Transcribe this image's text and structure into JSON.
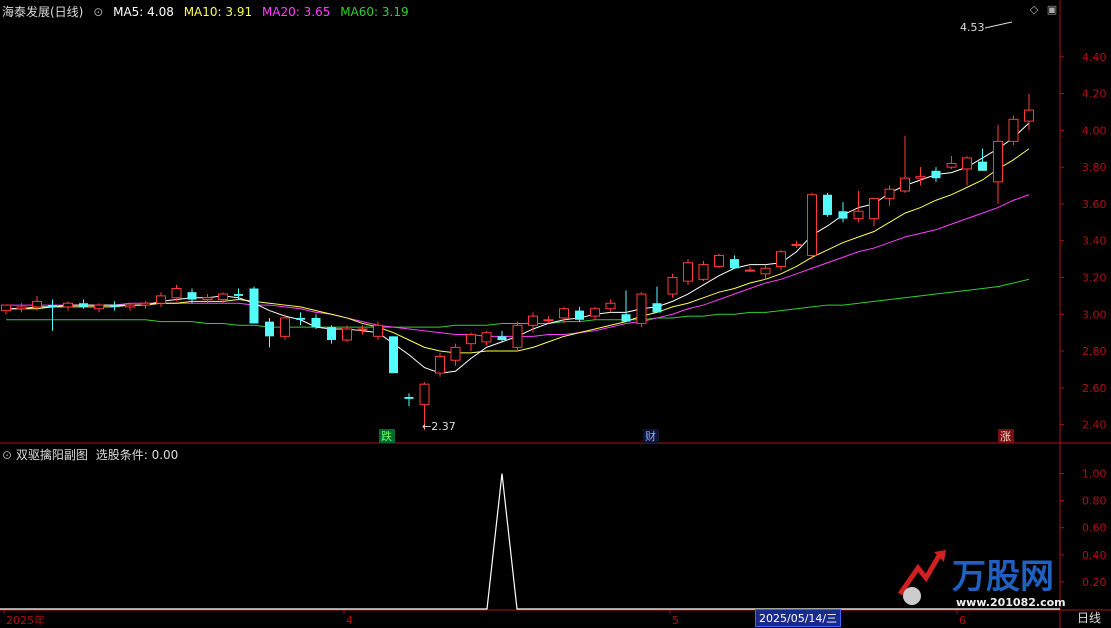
{
  "header": {
    "stock": "海泰发展(日线)",
    "ma5": "MA5: 4.08",
    "ma10": "MA10: 3.91",
    "ma20": "MA20: 3.65",
    "ma60": "MA60: 3.19"
  },
  "sub_header": {
    "title": "双驱擒阳副图",
    "condition": "选股条件: 0.00"
  },
  "price_axis": [
    "4.40",
    "4.20",
    "4.00",
    "3.80",
    "3.60",
    "3.40",
    "3.20",
    "3.00",
    "2.80",
    "2.60",
    "2.40"
  ],
  "sub_axis": [
    "1.00",
    "0.80",
    "0.60",
    "0.40",
    "0.20"
  ],
  "x_labels": [
    {
      "text": "2025年"
    },
    {
      "text": "4"
    },
    {
      "text": "5"
    },
    {
      "text": "6"
    }
  ],
  "cursor_date": "2025/05/14/三",
  "period_label": "日线",
  "annotations": {
    "high": "4.53",
    "low": "2.37",
    "marker_fall": "跌",
    "marker_fin": "财",
    "marker_rise": "涨"
  },
  "watermark": {
    "brand": "万股网",
    "url": "www.201082.com"
  },
  "colors": {
    "up": "#ff3b3b",
    "down": "#54fcfc",
    "ma5": "#ffffff",
    "ma10": "#ffff50",
    "ma20": "#ff40ff",
    "ma60": "#30d030",
    "axis": "#b01010",
    "sub_line": "#ffffff"
  },
  "chart_data": {
    "type": "candlestick",
    "y_range": [
      2.3,
      4.6
    ],
    "candles": [
      [
        3.02,
        3.05,
        3.0,
        3.05
      ],
      [
        3.03,
        3.06,
        3.01,
        3.04
      ],
      [
        3.04,
        3.1,
        3.02,
        3.07
      ],
      [
        3.05,
        3.08,
        2.91,
        3.04
      ],
      [
        3.04,
        3.07,
        3.02,
        3.06
      ],
      [
        3.06,
        3.08,
        3.03,
        3.04
      ],
      [
        3.03,
        3.06,
        3.01,
        3.05
      ],
      [
        3.05,
        3.07,
        3.02,
        3.04
      ],
      [
        3.04,
        3.06,
        3.02,
        3.05
      ],
      [
        3.05,
        3.07,
        3.03,
        3.06
      ],
      [
        3.06,
        3.12,
        3.04,
        3.1
      ],
      [
        3.09,
        3.16,
        3.07,
        3.14
      ],
      [
        3.12,
        3.14,
        3.06,
        3.08
      ],
      [
        3.08,
        3.11,
        3.06,
        3.09
      ],
      [
        3.08,
        3.12,
        3.06,
        3.11
      ],
      [
        3.11,
        3.14,
        3.08,
        3.1
      ],
      [
        3.14,
        3.15,
        2.95,
        2.95
      ],
      [
        2.96,
        2.98,
        2.82,
        2.88
      ],
      [
        2.88,
        3.0,
        2.86,
        2.98
      ],
      [
        2.98,
        3.01,
        2.94,
        2.97
      ],
      [
        2.98,
        3.0,
        2.92,
        2.93
      ],
      [
        2.93,
        2.94,
        2.84,
        2.86
      ],
      [
        2.86,
        2.94,
        2.85,
        2.92
      ],
      [
        2.92,
        2.94,
        2.89,
        2.92
      ],
      [
        2.88,
        2.96,
        2.86,
        2.94
      ],
      [
        2.88,
        2.88,
        2.68,
        2.68
      ],
      [
        2.55,
        2.57,
        2.5,
        2.54
      ],
      [
        2.51,
        2.63,
        2.37,
        2.62
      ],
      [
        2.68,
        2.79,
        2.66,
        2.77
      ],
      [
        2.75,
        2.84,
        2.72,
        2.82
      ],
      [
        2.84,
        2.9,
        2.8,
        2.89
      ],
      [
        2.85,
        2.91,
        2.83,
        2.9
      ],
      [
        2.88,
        2.91,
        2.85,
        2.86
      ],
      [
        2.82,
        2.96,
        2.8,
        2.94
      ],
      [
        2.94,
        3.01,
        2.9,
        2.99
      ],
      [
        2.97,
        2.99,
        2.95,
        2.97
      ],
      [
        2.98,
        3.04,
        2.95,
        3.03
      ],
      [
        3.02,
        3.04,
        2.96,
        2.97
      ],
      [
        2.99,
        3.04,
        2.97,
        3.03
      ],
      [
        3.03,
        3.08,
        3.01,
        3.06
      ],
      [
        3.0,
        3.13,
        2.98,
        2.96
      ],
      [
        2.95,
        3.12,
        2.93,
        3.11
      ],
      [
        3.06,
        3.15,
        3.03,
        3.01
      ],
      [
        3.11,
        3.22,
        3.09,
        3.2
      ],
      [
        3.18,
        3.3,
        3.16,
        3.28
      ],
      [
        3.19,
        3.29,
        3.18,
        3.27
      ],
      [
        3.26,
        3.33,
        3.25,
        3.32
      ],
      [
        3.3,
        3.32,
        3.25,
        3.25
      ],
      [
        3.24,
        3.26,
        3.23,
        3.24
      ],
      [
        3.22,
        3.27,
        3.19,
        3.25
      ],
      [
        3.26,
        3.35,
        3.24,
        3.34
      ],
      [
        3.38,
        3.4,
        3.36,
        3.38
      ],
      [
        3.32,
        3.66,
        3.3,
        3.65
      ],
      [
        3.65,
        3.66,
        3.53,
        3.54
      ],
      [
        3.56,
        3.61,
        3.5,
        3.52
      ],
      [
        3.52,
        3.67,
        3.5,
        3.56
      ],
      [
        3.52,
        3.63,
        3.48,
        3.63
      ],
      [
        3.63,
        3.7,
        3.59,
        3.68
      ],
      [
        3.67,
        3.97,
        3.66,
        3.74
      ],
      [
        3.74,
        3.8,
        3.7,
        3.75
      ],
      [
        3.78,
        3.8,
        3.72,
        3.74
      ],
      [
        3.8,
        3.86,
        3.79,
        3.82
      ],
      [
        3.79,
        3.86,
        3.7,
        3.85
      ],
      [
        3.83,
        3.9,
        3.78,
        3.78
      ],
      [
        3.72,
        4.03,
        3.6,
        3.94
      ],
      [
        3.94,
        4.08,
        3.92,
        4.06
      ],
      [
        4.05,
        4.2,
        4.0,
        4.11
      ]
    ],
    "ma5": [
      3.03,
      3.03,
      3.04,
      3.04,
      3.05,
      3.05,
      3.05,
      3.05,
      3.05,
      3.05,
      3.07,
      3.08,
      3.09,
      3.09,
      3.1,
      3.09,
      3.06,
      3.02,
      2.99,
      2.97,
      2.93,
      2.92,
      2.92,
      2.91,
      2.9,
      2.84,
      2.78,
      2.71,
      2.68,
      2.69,
      2.76,
      2.82,
      2.85,
      2.88,
      2.92,
      2.95,
      2.97,
      2.98,
      3.0,
      3.01,
      3.01,
      3.03,
      3.04,
      3.07,
      3.11,
      3.16,
      3.21,
      3.25,
      3.27,
      3.27,
      3.28,
      3.34,
      3.43,
      3.48,
      3.54,
      3.58,
      3.6,
      3.66,
      3.7,
      3.73,
      3.76,
      3.77,
      3.8,
      3.85,
      3.9,
      3.96,
      4.04
    ],
    "ma10": [
      3.03,
      3.03,
      3.03,
      3.04,
      3.04,
      3.04,
      3.04,
      3.04,
      3.05,
      3.05,
      3.06,
      3.06,
      3.07,
      3.07,
      3.07,
      3.08,
      3.07,
      3.06,
      3.05,
      3.04,
      3.02,
      3.0,
      2.98,
      2.95,
      2.93,
      2.9,
      2.86,
      2.82,
      2.8,
      2.79,
      2.79,
      2.8,
      2.8,
      2.8,
      2.82,
      2.85,
      2.88,
      2.9,
      2.92,
      2.94,
      2.96,
      2.99,
      3.01,
      3.04,
      3.06,
      3.09,
      3.12,
      3.14,
      3.17,
      3.19,
      3.22,
      3.26,
      3.31,
      3.35,
      3.39,
      3.42,
      3.45,
      3.5,
      3.55,
      3.58,
      3.62,
      3.65,
      3.69,
      3.73,
      3.79,
      3.84,
      3.9
    ],
    "ma20": [
      3.05,
      3.05,
      3.05,
      3.05,
      3.05,
      3.05,
      3.05,
      3.05,
      3.06,
      3.06,
      3.06,
      3.06,
      3.06,
      3.06,
      3.06,
      3.06,
      3.05,
      3.05,
      3.04,
      3.03,
      3.01,
      3.0,
      2.98,
      2.96,
      2.94,
      2.93,
      2.92,
      2.91,
      2.9,
      2.89,
      2.89,
      2.88,
      2.88,
      2.88,
      2.88,
      2.89,
      2.89,
      2.9,
      2.91,
      2.93,
      2.95,
      2.96,
      2.98,
      3.0,
      3.03,
      3.05,
      3.08,
      3.11,
      3.14,
      3.17,
      3.19,
      3.22,
      3.25,
      3.28,
      3.31,
      3.34,
      3.36,
      3.39,
      3.42,
      3.44,
      3.46,
      3.49,
      3.52,
      3.55,
      3.58,
      3.62,
      3.65
    ],
    "ma60": [
      2.97,
      2.97,
      2.97,
      2.97,
      2.97,
      2.97,
      2.97,
      2.97,
      2.97,
      2.97,
      2.96,
      2.96,
      2.96,
      2.95,
      2.95,
      2.94,
      2.94,
      2.93,
      2.93,
      2.93,
      2.93,
      2.93,
      2.93,
      2.93,
      2.93,
      2.93,
      2.93,
      2.93,
      2.93,
      2.94,
      2.94,
      2.94,
      2.95,
      2.95,
      2.95,
      2.95,
      2.96,
      2.96,
      2.97,
      2.97,
      2.97,
      2.97,
      2.98,
      2.98,
      2.99,
      2.99,
      3.0,
      3.0,
      3.01,
      3.01,
      3.02,
      3.03,
      3.04,
      3.05,
      3.05,
      3.06,
      3.07,
      3.08,
      3.09,
      3.1,
      3.11,
      3.12,
      3.13,
      3.14,
      3.15,
      3.17,
      3.19
    ],
    "sub_series": {
      "range": [
        0,
        1.1
      ],
      "spike_index": 32,
      "spike_value": 1.0
    }
  }
}
